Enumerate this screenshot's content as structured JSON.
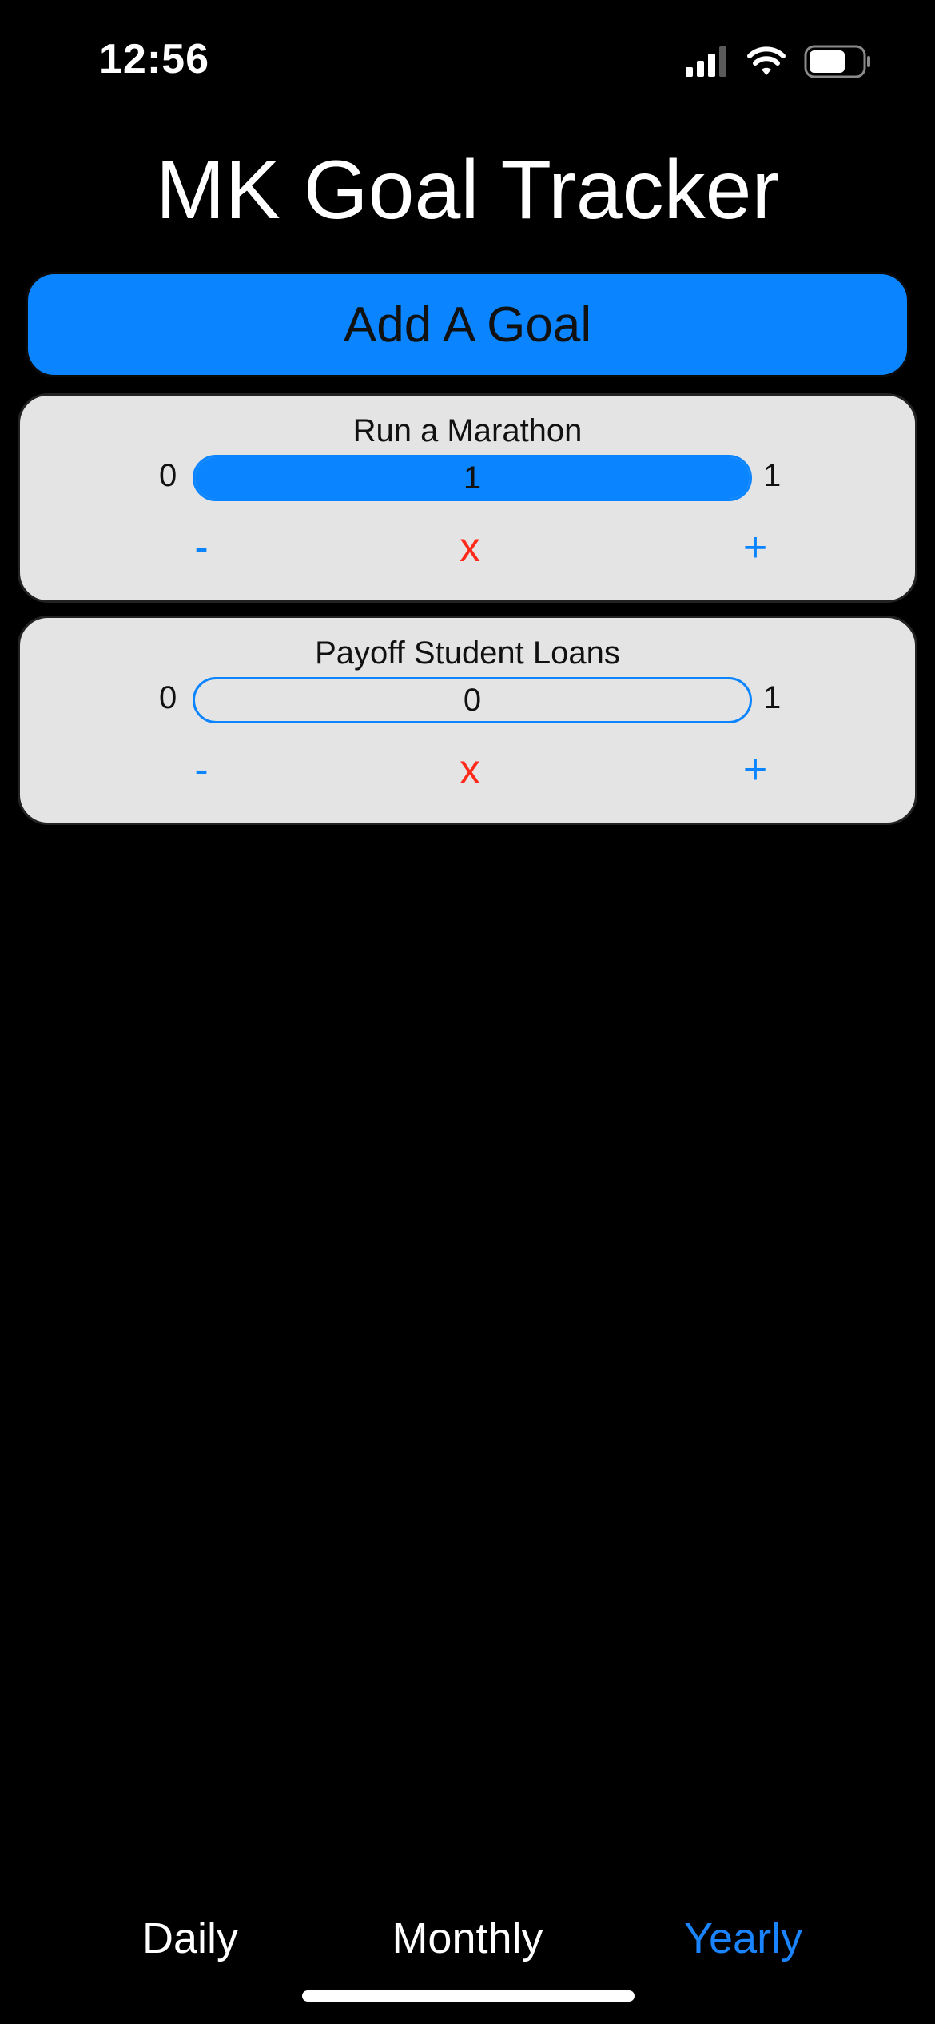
{
  "status": {
    "time": "12:56",
    "icons": [
      "cellular-signal-icon",
      "wifi-icon",
      "battery-icon"
    ]
  },
  "app": {
    "title": "MK Goal Tracker",
    "add_goal_label": "Add A Goal",
    "accent_color": "#0a84ff",
    "delete_color": "#ff2a1a"
  },
  "goals": [
    {
      "title": "Run a Marathon",
      "min": "0",
      "max": "1",
      "current": "1",
      "progress_fraction": 1.0,
      "minus_label": "-",
      "delete_label": "x",
      "plus_label": "+"
    },
    {
      "title": "Payoff Student Loans",
      "min": "0",
      "max": "1",
      "current": "0",
      "progress_fraction": 0.0,
      "minus_label": "-",
      "delete_label": "x",
      "plus_label": "+"
    }
  ],
  "tabs": [
    {
      "label": "Daily",
      "active": false
    },
    {
      "label": "Monthly",
      "active": false
    },
    {
      "label": "Yearly",
      "active": true
    }
  ]
}
